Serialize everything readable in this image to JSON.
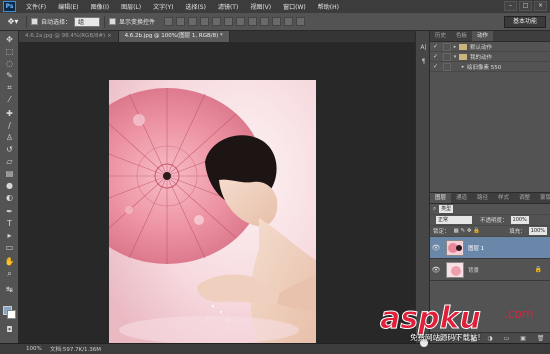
{
  "menubar": {
    "logo": "Ps",
    "items": [
      "文件(F)",
      "编辑(E)",
      "图像(I)",
      "图层(L)",
      "文字(Y)",
      "选择(S)",
      "滤镜(T)",
      "视图(V)",
      "窗口(W)",
      "帮助(H)"
    ]
  },
  "options": {
    "tool_icon": "move-tool-icon",
    "auto_select_label": "自动选择：",
    "auto_select_value": "组",
    "show_transform_label": "显示变换控件",
    "workspace_label": "基本功能"
  },
  "tabs": [
    {
      "label": "4.6.2a.jpg @ 98.4%(RGB/8#) ×",
      "active": false
    },
    {
      "label": "4.6.2b.jpg @ 100%(图层 1, RGB/8) *",
      "active": true
    }
  ],
  "panels": {
    "top_tabs": [
      "历史",
      "色板",
      "动作"
    ],
    "actions": [
      {
        "label": "默认动作",
        "checked": true,
        "type": "folder",
        "expanded": true
      },
      {
        "label": "我的动作",
        "checked": true,
        "type": "folder",
        "expanded": true
      },
      {
        "label": "绘旧像素 550",
        "checked": true,
        "type": "action",
        "expanded": false
      }
    ],
    "layers_tabs": [
      "图层",
      "通道",
      "路径",
      "样式",
      "调整",
      "蒙版"
    ],
    "kind_label": "类型",
    "blend_mode": "正常",
    "opacity_label": "不透明度：",
    "opacity_value": "100%",
    "lock_label": "锁定：",
    "fill_label": "填充：",
    "fill_value": "100%",
    "layers": [
      {
        "name": "图层 1",
        "selected": true,
        "locked": false
      },
      {
        "name": "背景",
        "selected": false,
        "locked": true
      }
    ]
  },
  "status": {
    "zoom": "100%",
    "doc_info": "文档:597.7K/1.36M"
  },
  "watermark": {
    "logo": "aspku",
    "text": "免费网站源码下载站!"
  },
  "colors": {
    "foreground": "#8ba7c5",
    "background": "#ffffff",
    "layer_selected": "#6a86a8",
    "watermark_red": "#e0203a"
  }
}
